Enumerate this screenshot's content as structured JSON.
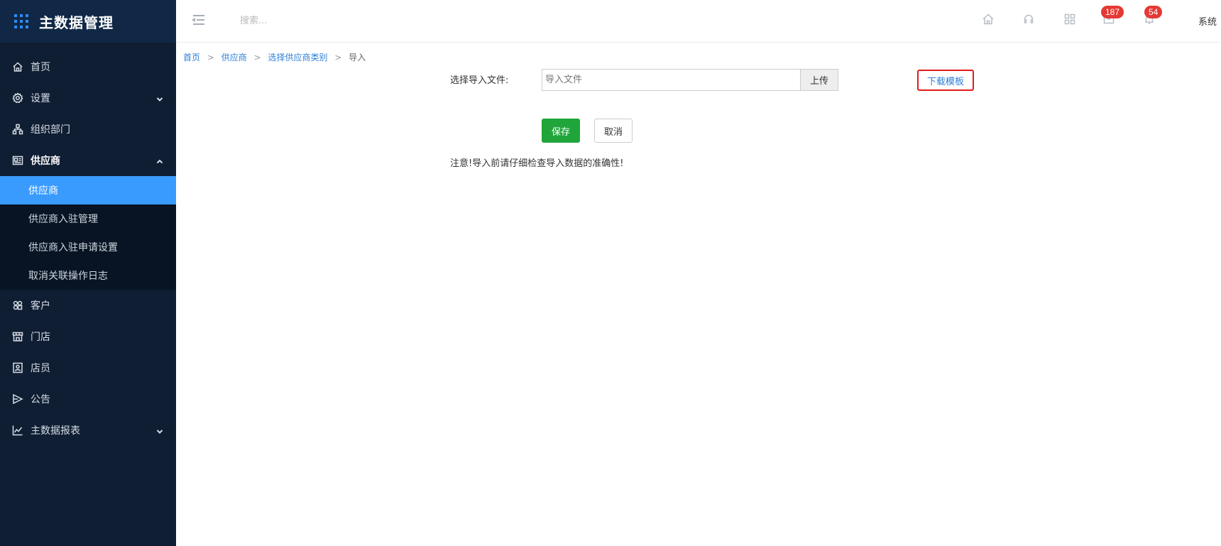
{
  "app": {
    "title": "主数据管理"
  },
  "sidebar": {
    "items": [
      {
        "label": "首页",
        "icon": "home-icon"
      },
      {
        "label": "设置",
        "icon": "gear-icon",
        "expandable": true
      },
      {
        "label": "组织部门",
        "icon": "org-icon"
      },
      {
        "label": "供应商",
        "icon": "supplier-icon",
        "expanded": true,
        "children": [
          {
            "label": "供应商",
            "active": true
          },
          {
            "label": "供应商入驻管理"
          },
          {
            "label": "供应商入驻申请设置"
          },
          {
            "label": "取消关联操作日志"
          }
        ]
      },
      {
        "label": "客户",
        "icon": "customer-icon"
      },
      {
        "label": "门店",
        "icon": "store-icon"
      },
      {
        "label": "店员",
        "icon": "staff-icon"
      },
      {
        "label": "公告",
        "icon": "announcement-icon"
      },
      {
        "label": "主数据报表",
        "icon": "chart-icon",
        "expandable": true
      }
    ]
  },
  "topbar": {
    "search_placeholder": "搜索...",
    "mail_badge": "187",
    "bell_badge": "54",
    "user_text": "系统"
  },
  "breadcrumb": {
    "home": "首页",
    "supplier": "供应商",
    "category": "选择供应商类别",
    "current": "导入",
    "sep": ">"
  },
  "form": {
    "label": "选择导入文件:",
    "file_placeholder": "导入文件",
    "upload_label": "上传",
    "download_label": "下载模板",
    "save_label": "保存",
    "cancel_label": "取消",
    "notice": "注意!导入前请仔细检查导入数据的准确性!"
  },
  "colors": {
    "sidebar_bg": "#0f1e33",
    "active": "#3a9bff",
    "save": "#20a53a",
    "highlight": "#e31b1b",
    "badge": "#e53935",
    "link": "#2f7fd8"
  }
}
